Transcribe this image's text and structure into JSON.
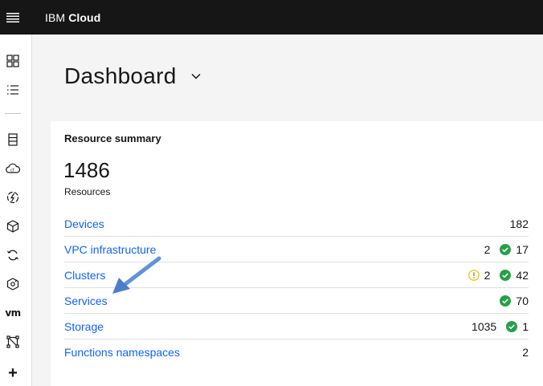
{
  "header": {
    "brand_prefix": "IBM",
    "brand_name": "Cloud",
    "menu_icon": "hamburger-menu-icon"
  },
  "sidenav": {
    "icons": [
      "dashboard-icon",
      "resource-list-icon",
      "classic-infrastructure-icon",
      "cloud-foundry-icon",
      "functions-icon",
      "kubernetes-icon",
      "openshift-icon",
      "satellite-icon",
      "vmware-icon",
      "vpc-icon",
      "add-icon"
    ],
    "vm_label": "vm",
    "plus_label": "+"
  },
  "page": {
    "title": "Dashboard"
  },
  "resource_summary": {
    "title": "Resource summary",
    "total": "1486",
    "total_label": "Resources",
    "rows": [
      {
        "label": "Devices",
        "plain": "182"
      },
      {
        "label": "VPC infrastructure",
        "plain": "2",
        "ok": "17"
      },
      {
        "label": "Clusters",
        "warn": "2",
        "ok": "42"
      },
      {
        "label": "Services",
        "ok": "70"
      },
      {
        "label": "Storage",
        "plain": "1035",
        "ok": "1"
      },
      {
        "label": "Functions namespaces",
        "plain": "2"
      }
    ]
  },
  "colors": {
    "topbar": "#161616",
    "link": "#0f62fe",
    "ok": "#24a148",
    "warning": "#f1c21b",
    "annotation_arrow": "#5b8fd6"
  }
}
